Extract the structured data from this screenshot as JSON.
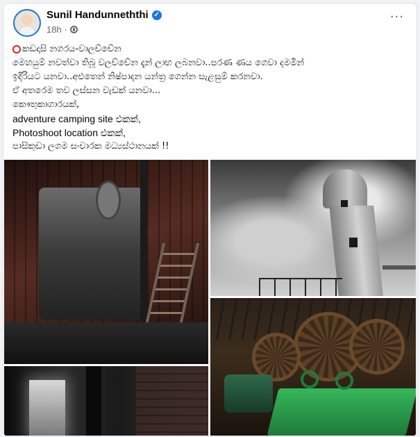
{
  "post": {
    "author": "Sunil Handunneththi",
    "time": "18h",
    "separator": "·",
    "more_label": "···",
    "lines": [
      "කඩදාසි නගරය-වාලච්චේන",
      "මෙහයුම් නවත්වා තිබූ වලච්චේන දැන් ලාභ ලබනවා..පරණ ණය ගෙවා දමමින්",
      "ඉදිරියට යනවා..අළුතෙන් නිෂ්පාදන යන්ත්‍ර ගෙන්න සැළසුම් කරනවා.",
      "ඒ අතරෙම තව ලස්සන වැඩක් යනවා...",
      " කෞතුකාගාරයක්,",
      "adventure camping site එකක්,",
      "Photoshoot  location එකක්,",
      "පාසිකුඩා ලගම සංචාරක මධ්‍යස්ථානයක් !!"
    ]
  },
  "icons": {
    "verified": "verified-badge-icon",
    "globe": "globe-icon",
    "marker": "red-circle-icon"
  },
  "colors": {
    "accent": "#1b74e4",
    "marker": "#e02020",
    "meta": "#65676b"
  }
}
